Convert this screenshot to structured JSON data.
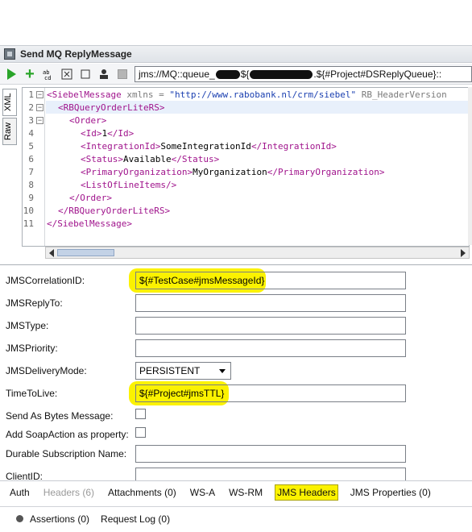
{
  "window": {
    "title": "Send MQ ReplyMessage"
  },
  "toolbar": {
    "endpoint_prefix": "jms://MQ::queue_",
    "endpoint_mid": "${",
    "endpoint_suffix": ".${#Project#DSReplyQueue}::"
  },
  "editor": {
    "tabs": [
      "XML",
      "Raw"
    ],
    "lines": [
      {
        "n": "1",
        "fold": "−"
      },
      {
        "n": "2",
        "fold": "−"
      },
      {
        "n": "3",
        "fold": "−"
      },
      {
        "n": "4",
        "fold": ""
      },
      {
        "n": "5",
        "fold": ""
      },
      {
        "n": "6",
        "fold": ""
      },
      {
        "n": "7",
        "fold": ""
      },
      {
        "n": "8",
        "fold": ""
      },
      {
        "n": "9",
        "fold": ""
      },
      {
        "n": "10",
        "fold": ""
      },
      {
        "n": "11",
        "fold": ""
      }
    ],
    "code": {
      "l1_tag": "<SiebelMessage",
      "l1_attr": " xmlns = ",
      "l1_val": "\"http://www.rabobank.nl/crm/siebel\"",
      "l1_attr2": " RB_HeaderVersion",
      "l2": "<RBQueryOrderLiteRS>",
      "l3": "<Order>",
      "l4_open": "<Id>",
      "l4_text": "1",
      "l4_close": "</Id>",
      "l5_open": "<IntegrationId>",
      "l5_text": "SomeIntegrationId",
      "l5_close": "</IntegrationId>",
      "l6_open": "<Status>",
      "l6_text": "Available",
      "l6_close": "</Status>",
      "l7_open": "<PrimaryOrganization>",
      "l7_text": "MyOrganization",
      "l7_close": "</PrimaryOrganization>",
      "l8": "<ListOfLineItems/>",
      "l9": "</Order>",
      "l10": "</RBQueryOrderLiteRS>",
      "l11": "</SiebelMessage>"
    }
  },
  "props": {
    "correlation_label": "JMSCorrelationID:",
    "correlation_value": "${#TestCase#jmsMessageId}",
    "replyto_label": "JMSReplyTo:",
    "type_label": "JMSType:",
    "priority_label": "JMSPriority:",
    "delivery_label": "JMSDeliveryMode:",
    "delivery_value": "PERSISTENT",
    "ttl_label": "TimeToLive:",
    "ttl_value": "${#Project#jmsTTL}",
    "bytes_label": "Send As Bytes Message:",
    "soap_label": "Add SoapAction as property:",
    "durable_label": "Durable Subscription Name:",
    "client_label": "ClientID:"
  },
  "bottom_tabs": {
    "auth": "Auth",
    "headers": "Headers (6)",
    "attachments": "Attachments (0)",
    "wsa": "WS-A",
    "wsrm": "WS-RM",
    "jms_headers": "JMS Headers",
    "jms_properties": "JMS Properties (0)"
  },
  "status_tabs": {
    "assertions": "Assertions (0)",
    "request_log": "Request Log (0)"
  },
  "colors": {
    "highlight": "#fbf200",
    "tag": "#a0148c",
    "value": "#1a3fb0"
  }
}
